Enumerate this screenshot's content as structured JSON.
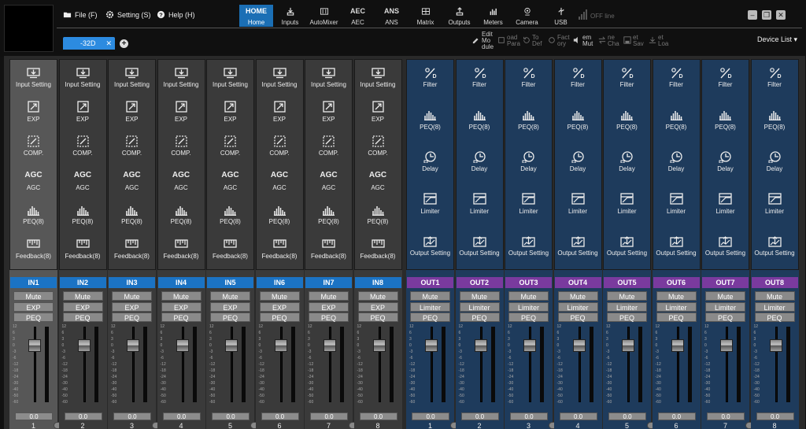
{
  "menu": [
    {
      "label": "File (F)",
      "icon": "folder-icon"
    },
    {
      "label": "Setting (S)",
      "icon": "gear-icon"
    },
    {
      "label": "Help (H)",
      "icon": "help-icon"
    }
  ],
  "nav": [
    {
      "glyph": "HOME",
      "label": "Home",
      "active": true
    },
    {
      "glyph": "",
      "label": "Inputs",
      "icon": "inputs-icon"
    },
    {
      "glyph": "",
      "label": "AutoMixer",
      "icon": "automixer-icon"
    },
    {
      "glyph": "AEC",
      "label": "AEC"
    },
    {
      "glyph": "ANS",
      "label": "ANS"
    },
    {
      "glyph": "",
      "label": "Matrix",
      "icon": "matrix-icon"
    },
    {
      "glyph": "",
      "label": "Outputs",
      "icon": "outputs-icon"
    },
    {
      "glyph": "",
      "label": "Meters",
      "icon": "meters-icon"
    },
    {
      "glyph": "",
      "label": "Camera",
      "icon": "camera-icon"
    },
    {
      "glyph": "",
      "label": "USB",
      "icon": "usb-icon"
    }
  ],
  "status": {
    "offline": "OFF line"
  },
  "window": {
    "minimize": "–",
    "restore": "❐",
    "close": "✕"
  },
  "tab": {
    "label": "-32D",
    "close": "✕",
    "add": "+"
  },
  "toolbar": [
    {
      "label": "Edit Mo dule",
      "icon": "edit-module-icon",
      "dim": false
    },
    {
      "label": "oad Para",
      "icon": "load-param-icon",
      "dim": true
    },
    {
      "label": "To Def",
      "icon": "to-default-icon",
      "dim": true
    },
    {
      "label": "Fact ory",
      "icon": "factory-icon",
      "dim": true
    },
    {
      "label": "em Mut",
      "icon": "mute-icon",
      "dim": false
    },
    {
      "label": "ne Cha",
      "icon": "change-icon",
      "dim": true
    },
    {
      "label": "et Sav",
      "icon": "save-icon",
      "dim": true
    },
    {
      "label": "et Loa",
      "icon": "load-icon",
      "dim": true
    }
  ],
  "device_list": "Device List",
  "input_processing": [
    {
      "label": "Input Setting",
      "icon": "input-setting-icon"
    },
    {
      "label": "EXP",
      "icon": "expander-icon"
    },
    {
      "label": "COMP.",
      "icon": "compressor-icon"
    },
    {
      "label": "AGC",
      "icon": "agc-icon",
      "glyph": "AGC"
    },
    {
      "label": "PEQ(8)",
      "icon": "peq-icon"
    },
    {
      "label": "Feedback(8)",
      "icon": "feedback-icon"
    }
  ],
  "output_processing": [
    {
      "label": "Filter",
      "icon": "filter-icon"
    },
    {
      "label": "PEQ(8)",
      "icon": "peq-icon"
    },
    {
      "label": "Delay",
      "icon": "delay-icon"
    },
    {
      "label": "Limiter",
      "icon": "limiter-icon"
    },
    {
      "label": "Output Setting",
      "icon": "output-setting-icon"
    }
  ],
  "inputs": [
    {
      "name": "IN1",
      "buttons": [
        "Mute",
        "EXP",
        "PEQ"
      ],
      "value": "0.0",
      "num": "1",
      "highlight": true
    },
    {
      "name": "IN2",
      "buttons": [
        "Mute",
        "EXP",
        "PEQ"
      ],
      "value": "0.0",
      "num": "2"
    },
    {
      "name": "IN3",
      "buttons": [
        "Mute",
        "EXP",
        "PEQ"
      ],
      "value": "0.0",
      "num": "3"
    },
    {
      "name": "IN4",
      "buttons": [
        "Mute",
        "EXP",
        "PEQ"
      ],
      "value": "0.0",
      "num": "4"
    },
    {
      "name": "IN5",
      "buttons": [
        "Mute",
        "EXP",
        "PEQ"
      ],
      "value": "0.0",
      "num": "5"
    },
    {
      "name": "IN6",
      "buttons": [
        "Mute",
        "EXP",
        "PEQ"
      ],
      "value": "0.0",
      "num": "6"
    },
    {
      "name": "IN7",
      "buttons": [
        "Mute",
        "EXP",
        "PEQ"
      ],
      "value": "0.0",
      "num": "7"
    },
    {
      "name": "IN8",
      "buttons": [
        "Mute",
        "EXP",
        "PEQ"
      ],
      "value": "0.0",
      "num": "8"
    }
  ],
  "outputs": [
    {
      "name": "OUT1",
      "buttons": [
        "Mute",
        "Limiter",
        "PEQ"
      ],
      "value": "0.0",
      "num": "1"
    },
    {
      "name": "OUT2",
      "buttons": [
        "Mute",
        "Limiter",
        "PEQ"
      ],
      "value": "0.0",
      "num": "2"
    },
    {
      "name": "OUT3",
      "buttons": [
        "Mute",
        "Limiter",
        "PEQ"
      ],
      "value": "0.0",
      "num": "3"
    },
    {
      "name": "OUT4",
      "buttons": [
        "Mute",
        "Limiter",
        "PEQ"
      ],
      "value": "0.0",
      "num": "4"
    },
    {
      "name": "OUT5",
      "buttons": [
        "Mute",
        "Limiter",
        "PEQ"
      ],
      "value": "0.0",
      "num": "5"
    },
    {
      "name": "OUT6",
      "buttons": [
        "Mute",
        "Limiter",
        "PEQ"
      ],
      "value": "0.0",
      "num": "6"
    },
    {
      "name": "OUT7",
      "buttons": [
        "Mute",
        "Limiter",
        "PEQ"
      ],
      "value": "0.0",
      "num": "7"
    },
    {
      "name": "OUT8",
      "buttons": [
        "Mute",
        "Limiter",
        "PEQ"
      ],
      "value": "0.0",
      "num": "8"
    }
  ],
  "fader_scale": [
    "12",
    "6",
    "3",
    "0",
    "-3",
    "-6",
    "-12",
    "-18",
    "-24",
    "-30",
    "-40",
    "-50",
    "-60"
  ],
  "fader_level_db": 0,
  "colors": {
    "input_label": "#1b73c4",
    "output_label": "#7a3a9e",
    "active_nav": "#1b6fb5",
    "output_panel": "#1e3b5c"
  }
}
